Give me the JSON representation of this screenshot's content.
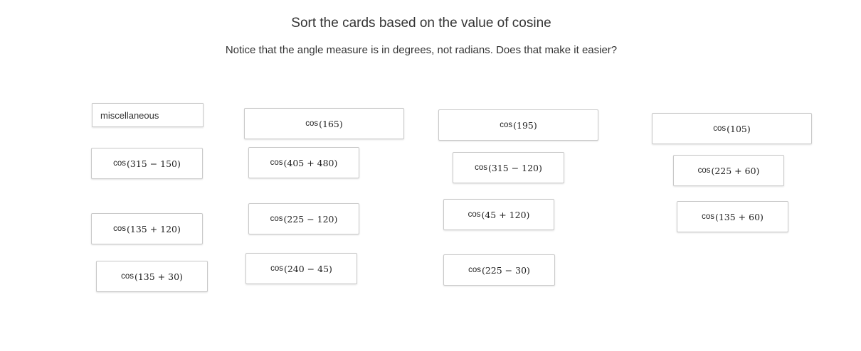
{
  "header": {
    "title": "Sort the cards based on the value of cosine",
    "subtitle": "Notice that the angle measure is in degrees, not radians. Does that make it easier?"
  },
  "category_label": "miscellaneous",
  "cards": [
    {
      "fn": "cos",
      "arg": "(315 − 150)"
    },
    {
      "fn": "cos",
      "arg": "(135 + 120)"
    },
    {
      "fn": "cos",
      "arg": "(135 + 30)"
    },
    {
      "fn": "cos",
      "arg": "(165)"
    },
    {
      "fn": "cos",
      "arg": "(405 + 480)"
    },
    {
      "fn": "cos",
      "arg": "(225 − 120)"
    },
    {
      "fn": "cos",
      "arg": "(240 − 45)"
    },
    {
      "fn": "cos",
      "arg": "(195)"
    },
    {
      "fn": "cos",
      "arg": "(315 − 120)"
    },
    {
      "fn": "cos",
      "arg": "(45 + 120)"
    },
    {
      "fn": "cos",
      "arg": "(225 − 30)"
    },
    {
      "fn": "cos",
      "arg": "(105)"
    },
    {
      "fn": "cos",
      "arg": "(225 + 60)"
    },
    {
      "fn": "cos",
      "arg": "(135 + 60)"
    }
  ]
}
